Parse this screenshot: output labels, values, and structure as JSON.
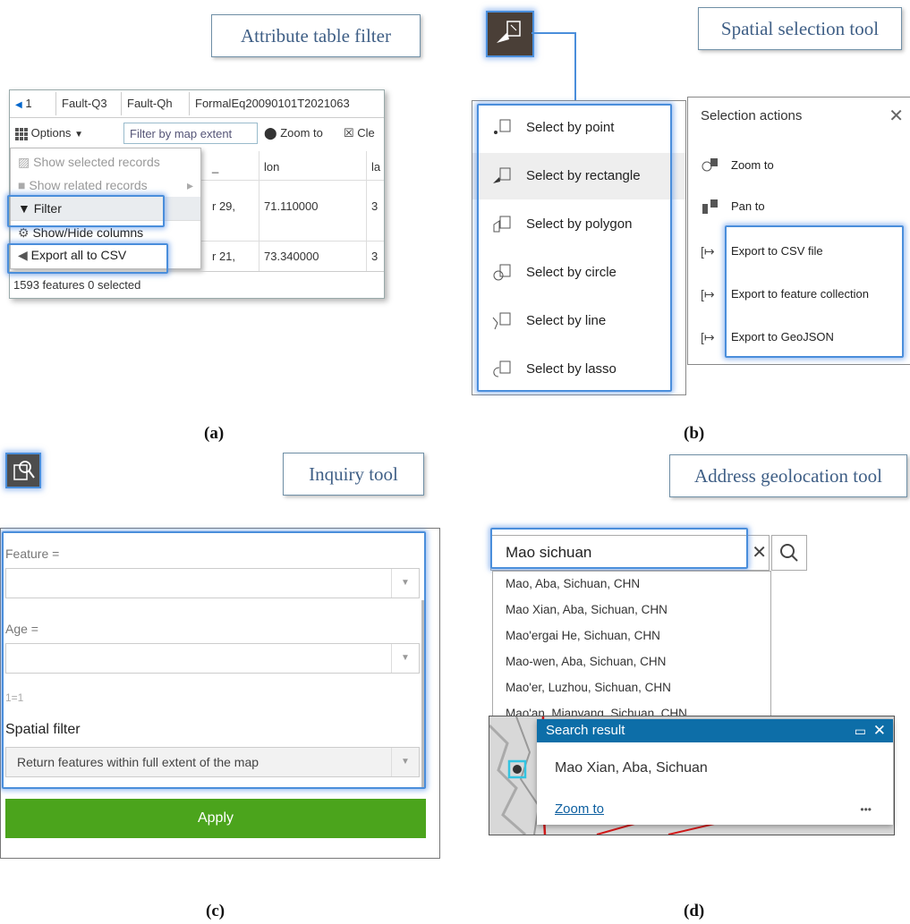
{
  "panel_a": {
    "callout": "Attribute table filter",
    "tabs": [
      "1",
      "Fault-Q3",
      "Fault-Qh",
      "FormalEq20090101T2021063"
    ],
    "toolbar": {
      "options": "Options",
      "filter_extent": "Filter by map extent",
      "zoom_to": "Zoom to",
      "clear": "Cle"
    },
    "menu": [
      "Show selected records",
      "Show related records",
      "Filter",
      "Show/Hide columns",
      "Export all to CSV"
    ],
    "columns": [
      "_",
      "lon",
      "la"
    ],
    "rows": [
      [
        "r 29,",
        "71.110000",
        "3"
      ],
      [
        "r 21,",
        "73.340000",
        "3"
      ]
    ],
    "status": "1593 features 0 selected",
    "label": "(a)"
  },
  "panel_b": {
    "callout": "Spatial selection tool",
    "select_items": [
      "Select by point",
      "Select by rectangle",
      "Select by polygon",
      "Select by circle",
      "Select by line",
      "Select by lasso"
    ],
    "actions_title": "Selection actions",
    "actions": [
      "Zoom to",
      "Pan to",
      "Export to CSV file",
      "Export to feature collection",
      "Export to GeoJSON"
    ],
    "label": "(b)"
  },
  "panel_c": {
    "callout": "Inquiry tool",
    "feature_label": "Feature =",
    "age_label": "Age =",
    "expr": "1=1",
    "spatial_filter_label": "Spatial filter",
    "spatial_filter_value": "Return features within full extent of the map",
    "apply": "Apply",
    "label": "(c)"
  },
  "panel_d": {
    "callout": "Address geolocation tool",
    "search_value": "Mao sichuan",
    "suggestions": [
      "Mao, Aba, Sichuan, CHN",
      "Mao Xian, Aba, Sichuan, CHN",
      "Mao'ergai He, Sichuan, CHN",
      "Mao-wen, Aba, Sichuan, CHN",
      "Mao'er, Luzhou, Sichuan, CHN",
      "Mao'an, Mianyang, Sichuan, CHN"
    ],
    "popup_title": "Search result",
    "popup_text": "Mao Xian, Aba, Sichuan",
    "popup_link": "Zoom to",
    "more": "•••",
    "label": "(d)"
  },
  "colors": {
    "highlight": "#4a8edb",
    "apply_green": "#4ba41c",
    "popup_header": "#0d6ea8",
    "callout_text": "#3f5f86"
  }
}
